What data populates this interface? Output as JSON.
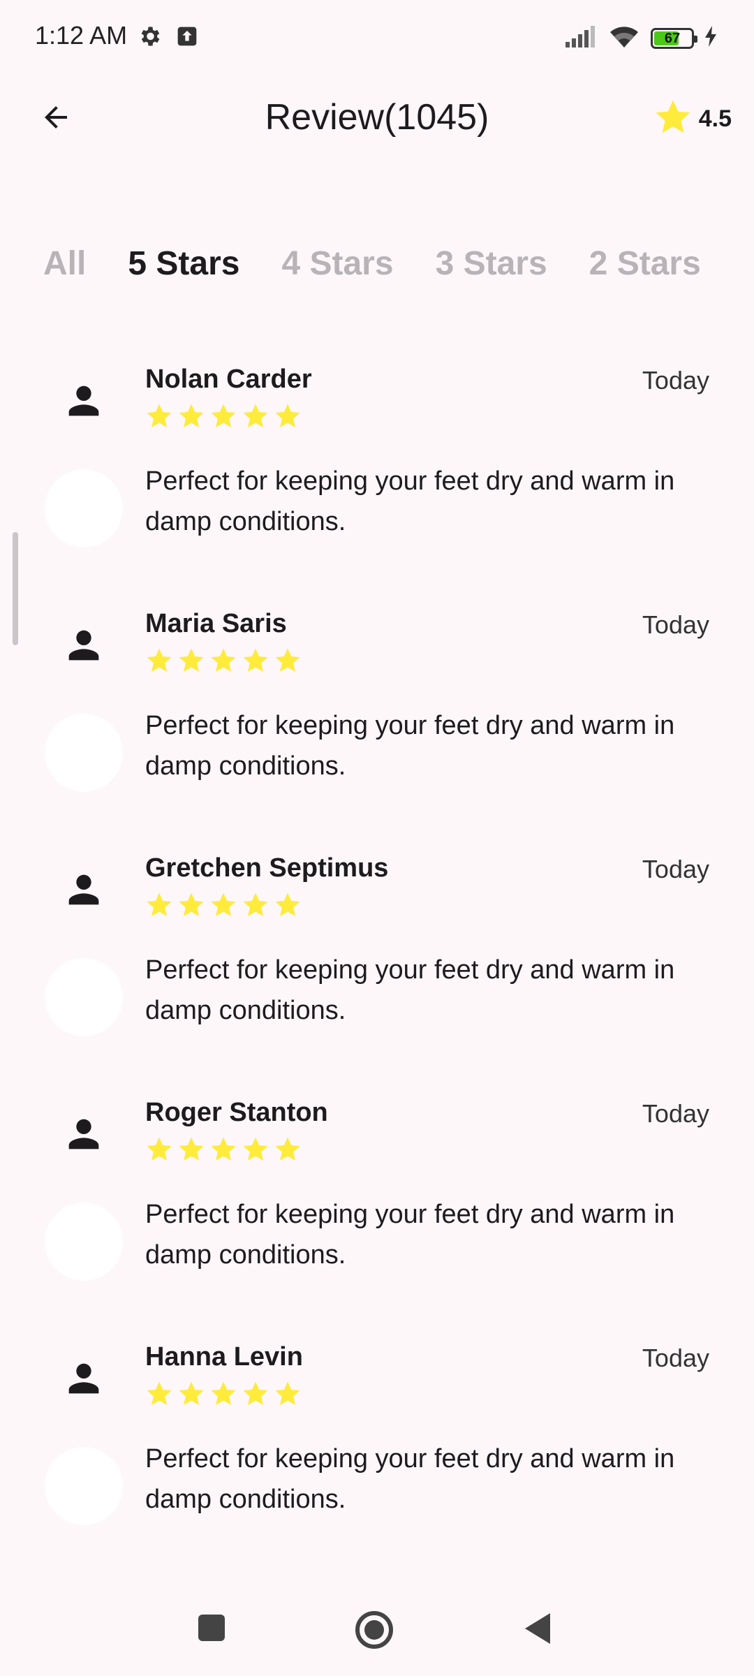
{
  "status_bar": {
    "time": "1:12 AM",
    "battery_level": "67",
    "battery_fraction": 0.67,
    "icons": [
      "settings-gear-icon",
      "upload-icon",
      "signal-icon",
      "wifi-icon",
      "battery-icon",
      "charging-bolt-icon"
    ]
  },
  "header": {
    "back_icon": "arrow-back-icon",
    "title": "Review(1045)",
    "rating_icon": "star-icon",
    "rating_value": "4.5"
  },
  "tabs": [
    {
      "label": "All",
      "active": false
    },
    {
      "label": "5 Stars",
      "active": true
    },
    {
      "label": "4 Stars",
      "active": false
    },
    {
      "label": "3 Stars",
      "active": false
    },
    {
      "label": "2 Stars",
      "active": false
    }
  ],
  "reviews": [
    {
      "name": "Nolan Carder",
      "date": "Today",
      "stars": 5,
      "text": "Perfect for keeping your feet dry and warm in damp conditions."
    },
    {
      "name": "Maria Saris",
      "date": "Today",
      "stars": 5,
      "text": "Perfect for keeping your feet dry and warm in damp conditions."
    },
    {
      "name": "Gretchen Septimus",
      "date": "Today",
      "stars": 5,
      "text": "Perfect for keeping your feet dry and warm in damp conditions."
    },
    {
      "name": "Roger Stanton",
      "date": "Today",
      "stars": 5,
      "text": "Perfect for keeping your feet dry and warm in damp conditions."
    },
    {
      "name": "Hanna Levin",
      "date": "Today",
      "stars": 5,
      "text": "Perfect for keeping your feet dry and warm in damp conditions."
    }
  ],
  "nav_bar": {
    "icons": [
      "recent-apps-icon",
      "home-icon",
      "back-triangle-icon"
    ]
  },
  "colors": {
    "background": "#FDF7FA",
    "star": "#FFEB3B",
    "inactive_tab": "#B7B3B7",
    "text": "#1d1b1e"
  }
}
